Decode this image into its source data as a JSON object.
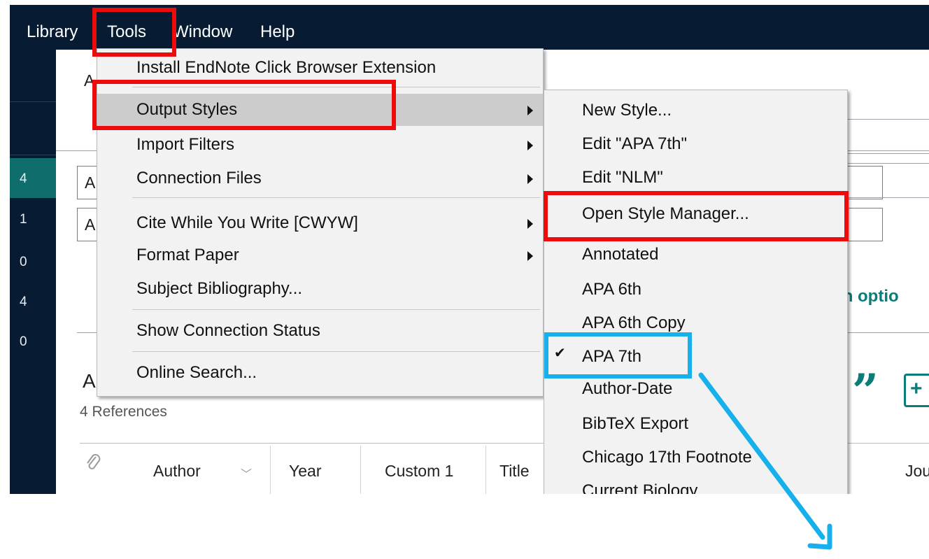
{
  "menubar": {
    "items": [
      "Library",
      "Tools",
      "Window",
      "Help"
    ]
  },
  "sidebar": {
    "counts": [
      "4",
      "1",
      "0",
      "4",
      "0"
    ]
  },
  "main": {
    "tab_partial": "A",
    "field1_partial": "A",
    "field2_partial": "A",
    "search_options_partial": "rch optio",
    "group_title_partial": "A",
    "references_count": "4 References",
    "columns": [
      "Author",
      "Year",
      "Custom 1",
      "Title",
      "Jou"
    ]
  },
  "tools_menu": {
    "items": [
      {
        "label": "Install EndNote Click Browser Extension",
        "submenu": false
      },
      {
        "label": "Output Styles",
        "submenu": true,
        "highlighted": true
      },
      {
        "label": "Import Filters",
        "submenu": true
      },
      {
        "label": "Connection Files",
        "submenu": true
      },
      {
        "label": "Cite While You Write [CWYW]",
        "submenu": true
      },
      {
        "label": "Format Paper",
        "submenu": true
      },
      {
        "label": "Subject Bibliography...",
        "submenu": false
      },
      {
        "label": "Show Connection Status",
        "submenu": false
      },
      {
        "label": "Online Search...",
        "submenu": false
      }
    ]
  },
  "output_styles_menu": {
    "items": [
      {
        "label": "New Style..."
      },
      {
        "label": "Edit \"APA 7th\""
      },
      {
        "label": "Edit \"NLM\""
      },
      {
        "label": "Open Style Manager..."
      },
      {
        "label": "Annotated"
      },
      {
        "label": "APA 6th"
      },
      {
        "label": "APA 6th Copy"
      },
      {
        "label": "APA 7th",
        "checked": true
      },
      {
        "label": "Author-Date"
      },
      {
        "label": "BibTeX Export"
      },
      {
        "label": "Chicago 17th Footnote"
      },
      {
        "label": "Current Biology"
      }
    ],
    "check_glyph": "✔"
  },
  "annotations": {
    "red_box_color": "#ec0c0c",
    "blue_box_color": "#16b0ec"
  }
}
